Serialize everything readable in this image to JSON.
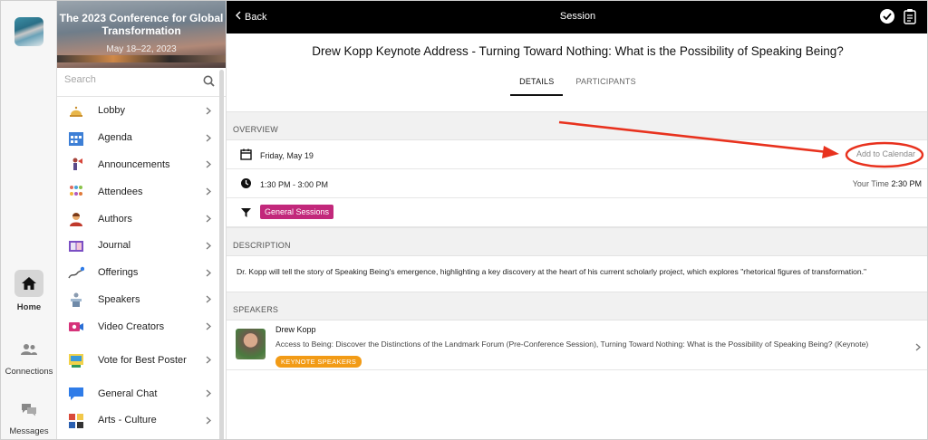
{
  "banner": {
    "title": "The 2023 Conference for Global Transformation",
    "dates": "May 18–22, 2023"
  },
  "search": {
    "placeholder": "Search"
  },
  "sidebar": {
    "items": [
      {
        "label": "Lobby",
        "icon": "bell-icon"
      },
      {
        "label": "Agenda",
        "icon": "calendar-icon"
      },
      {
        "label": "Announcements",
        "icon": "megaphone-icon"
      },
      {
        "label": "Attendees",
        "icon": "people-icon"
      },
      {
        "label": "Authors",
        "icon": "author-icon"
      },
      {
        "label": "Journal",
        "icon": "book-icon"
      },
      {
        "label": "Offerings",
        "icon": "chart-icon"
      },
      {
        "label": "Speakers",
        "icon": "podium-icon"
      },
      {
        "label": "Video Creators",
        "icon": "video-icon"
      },
      {
        "label": "Vote for Best Poster",
        "icon": "poster-icon"
      },
      {
        "label": "General Chat",
        "icon": "chat-icon"
      },
      {
        "label": "Arts - Culture",
        "icon": "palette-icon"
      }
    ]
  },
  "rail": {
    "home": "Home",
    "connections": "Connections",
    "messages": "Messages"
  },
  "topbar": {
    "back": "Back",
    "title": "Session"
  },
  "session": {
    "title": "Drew Kopp Keynote Address - Turning Toward Nothing: What is the Possibility of Speaking Being?",
    "tabs": [
      "DETAILS",
      "PARTICIPANTS"
    ],
    "overview_label": "OVERVIEW",
    "date": "Friday, May 19",
    "add_to_calendar": "Add to Calendar",
    "time": "1:30 PM - 3:00 PM",
    "your_time_label": "Your Time",
    "your_time_value": "2:30 PM",
    "track": "General Sessions",
    "description_label": "DESCRIPTION",
    "description": "Dr. Kopp will tell the story of Speaking Being's emergence, highlighting a key discovery at the heart of his current scholarly project, which explores \"rhetorical figures of transformation.\"",
    "speakers_label": "SPEAKERS"
  },
  "speaker": {
    "name": "Drew Kopp",
    "sessions": "Access to Being: Discover the Distinctions of the Landmark Forum (Pre-Conference Session), Turning Toward Nothing: What is the Possibility of Speaking Being? (Keynote)",
    "badge": "KEYNOTE SPEAKERS"
  },
  "colors": {
    "track_badge": "#c2287b",
    "speaker_badge": "#f29b16",
    "annotation": "#e8321e"
  }
}
